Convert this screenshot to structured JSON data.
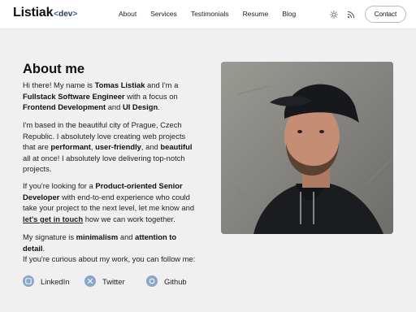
{
  "header": {
    "logo_name": "Listiak",
    "logo_dev": "dev",
    "nav": [
      {
        "label": "About"
      },
      {
        "label": "Services"
      },
      {
        "label": "Testimonials"
      },
      {
        "label": "Resume"
      },
      {
        "label": "Blog"
      }
    ],
    "contact_label": "Contact"
  },
  "about": {
    "title": "About me",
    "p1": [
      "Hi there! My name is ",
      "Tomas Listiak",
      " and I'm a ",
      "Fullstack Software Engineer",
      " with a focus on ",
      "Frontend Development",
      " and ",
      "UI Design",
      "."
    ],
    "p2": [
      "I'm based in the beautiful city of Prague, Czech Republic. I absolutely love creating web projects that are ",
      "performant",
      ", ",
      "user-friendly",
      ", and ",
      "beautiful",
      " all at once! I absolutely love delivering top-notch projects."
    ],
    "p3": [
      "If you're looking for a ",
      "Product-oriented Senior Developer",
      " with end-to-end experience who could take your project to the next level, let me know and ",
      "let's get in touch",
      " how we can work together."
    ],
    "p4": [
      "My signature is ",
      "minimalism",
      " and ",
      "attention to detail",
      "."
    ],
    "p5": "If you're curious about my work, you can follow me:",
    "social": [
      {
        "label": "LinkedIn",
        "icon": "linkedin-icon"
      },
      {
        "label": "Twitter",
        "icon": "twitter-icon"
      },
      {
        "label": "Github",
        "icon": "github-icon"
      }
    ]
  },
  "colors": {
    "accent": "#2b57c6",
    "social_icon": "#8aa6c8"
  }
}
